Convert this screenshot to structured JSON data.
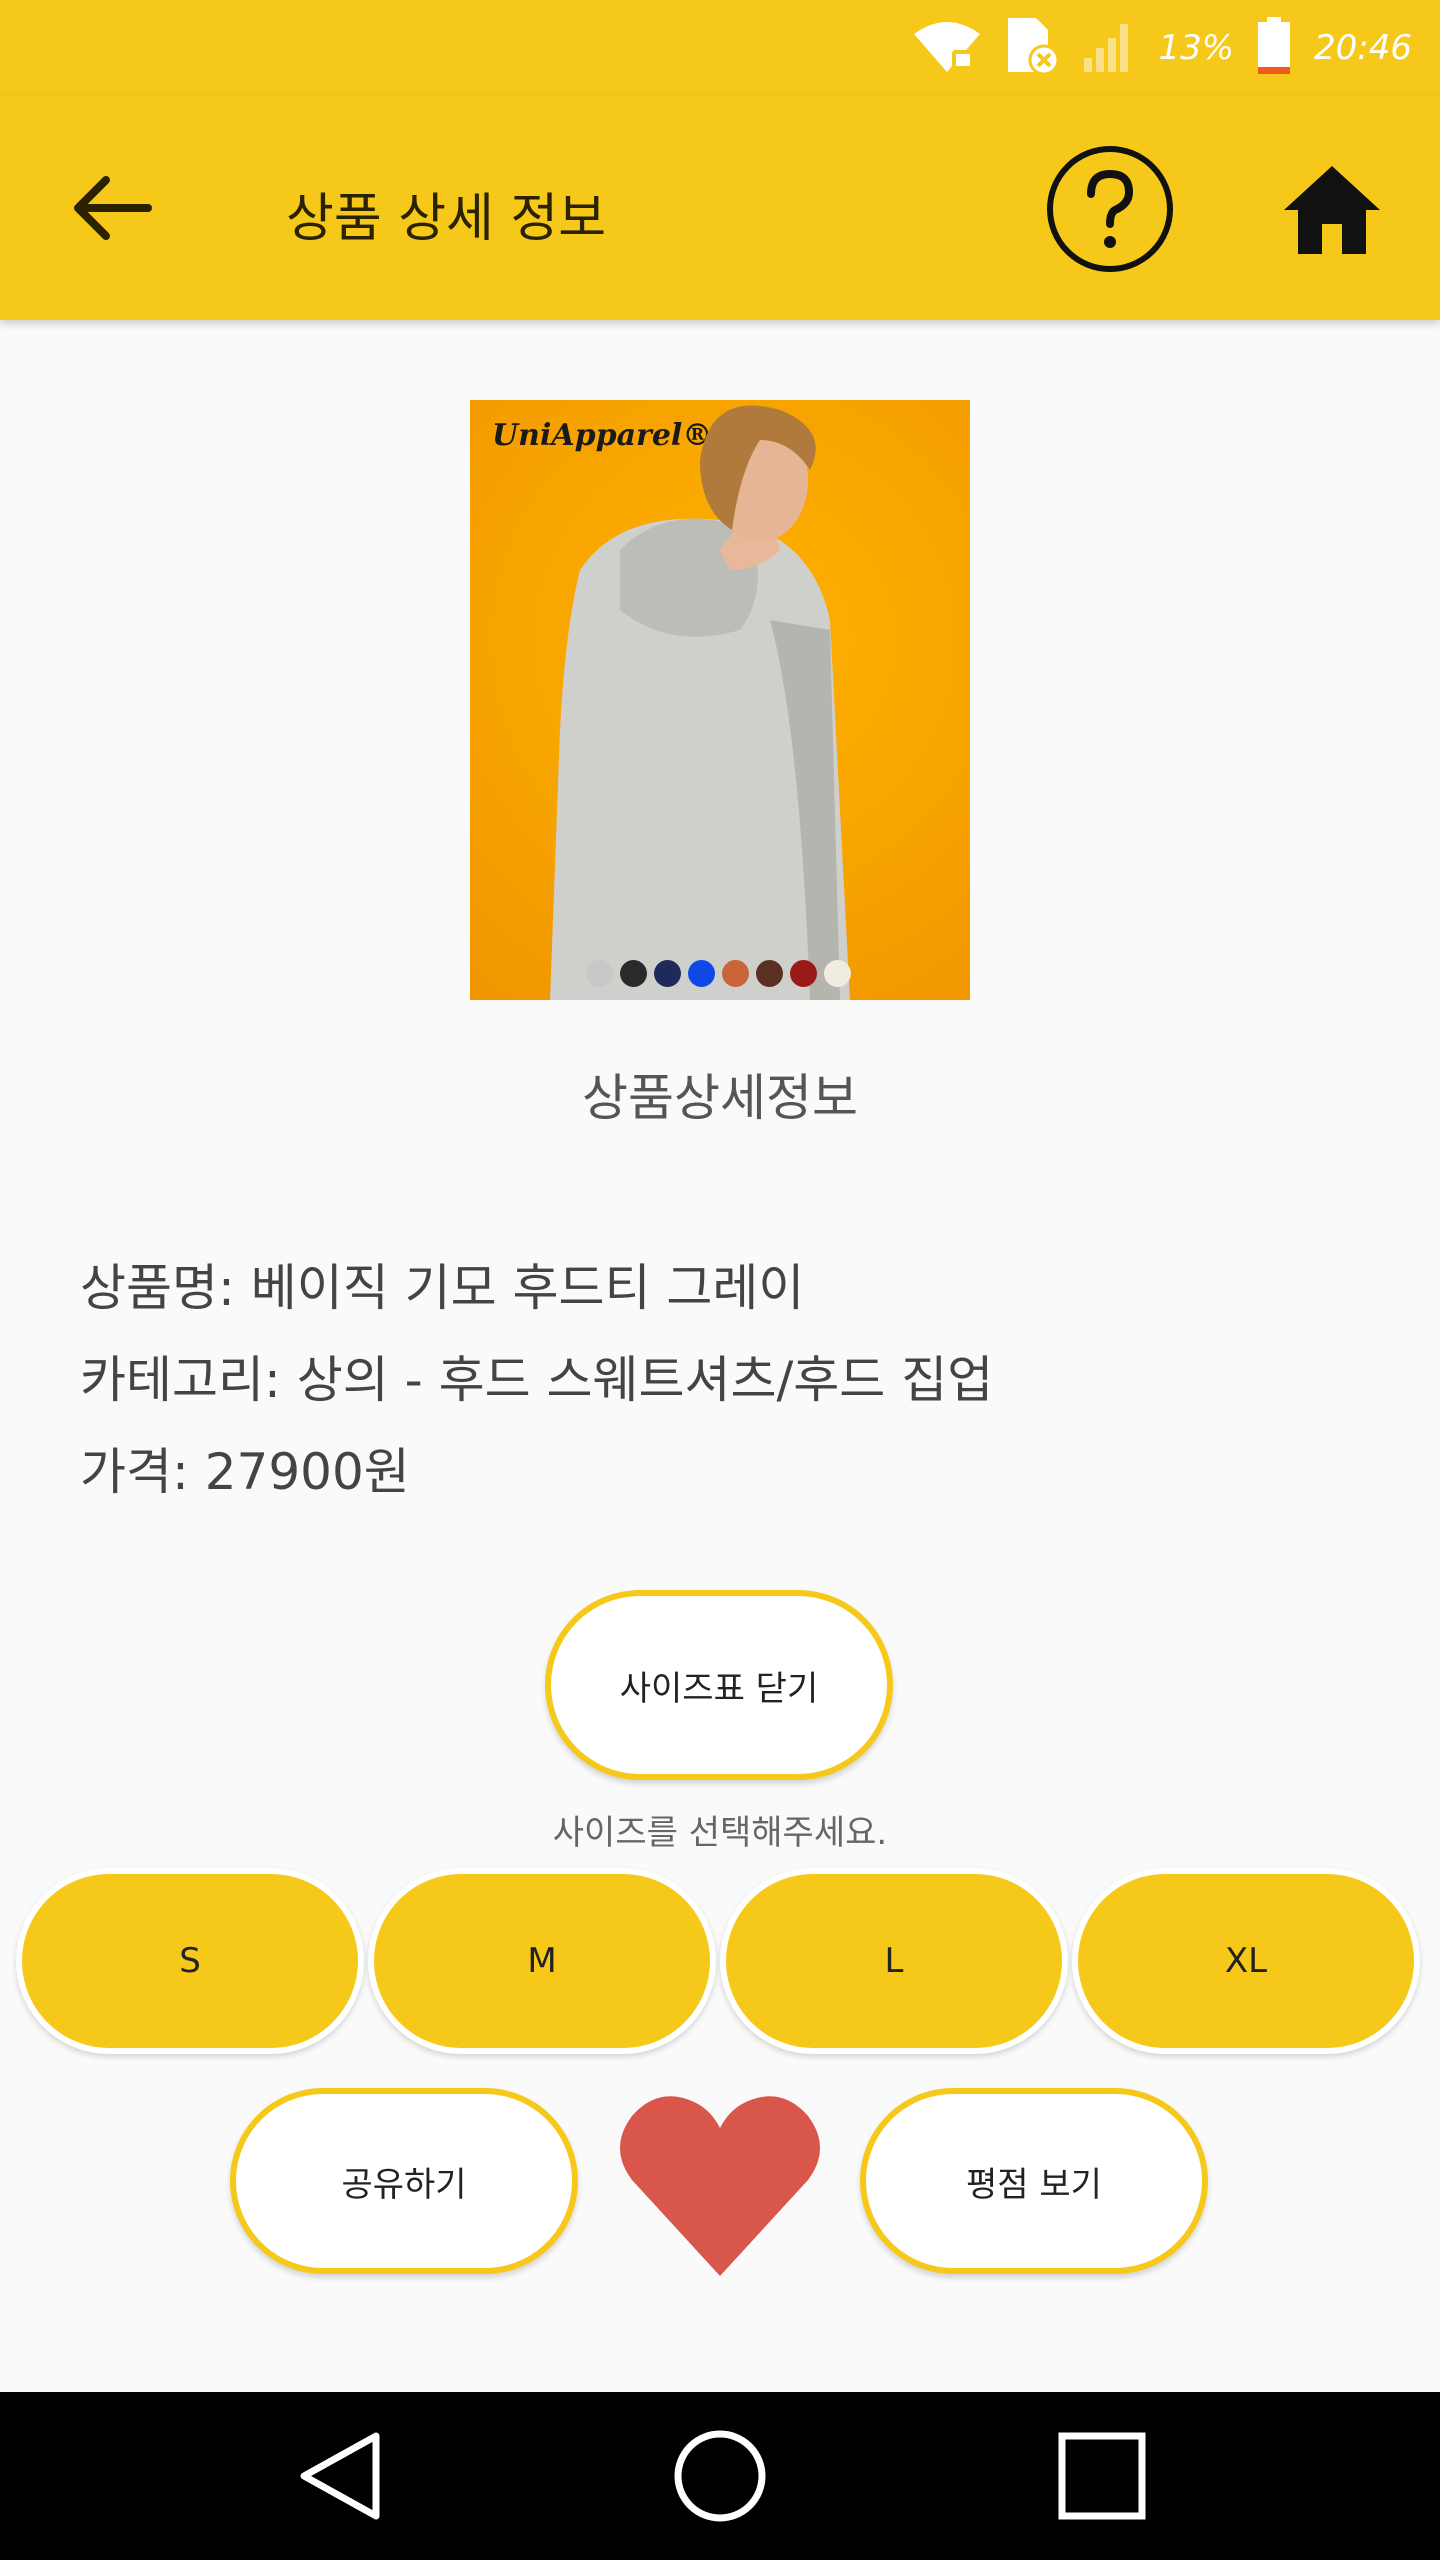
{
  "status_bar": {
    "battery_text": "13%",
    "time": "20:46",
    "icons": [
      "wifi-locked-icon",
      "sim-error-icon",
      "signal-icon",
      "battery-icon"
    ]
  },
  "app_bar": {
    "title": "상품 상세 정보",
    "back_icon": "arrow-left-icon",
    "help_icon": "help-circle-icon",
    "home_icon": "home-icon"
  },
  "product": {
    "brand_logo": "UniApparel®",
    "swatch_colors": [
      "#c8c8c8",
      "#2a2a2a",
      "#1f2a5a",
      "#1048e8",
      "#c8653a",
      "#5a3022",
      "#9a1a1a",
      "#f0ece0"
    ]
  },
  "details": {
    "section_title": "상품상세정보",
    "name_line": "상품명: 베이직 기모 후드티 그레이",
    "category_line": "카테고리: 상의 - 후드 스웨트셔츠/후드 집업",
    "price_line": "가격: 27900원"
  },
  "size_chart_button": "사이즈표 닫기",
  "size_hint": "사이즈를 선택해주세요.",
  "sizes": [
    "S",
    "M",
    "L",
    "XL"
  ],
  "actions": {
    "share_label": "공유하기",
    "rating_label": "평점 보기",
    "like_icon": "heart-icon",
    "heart_color": "#d9574a"
  },
  "colors": {
    "accent": "#f6c81a",
    "background": "#fafafa",
    "nav_bar": "#000000"
  },
  "nav_bar": {
    "icons": [
      "back-triangle-icon",
      "home-circle-icon",
      "recents-square-icon"
    ]
  }
}
